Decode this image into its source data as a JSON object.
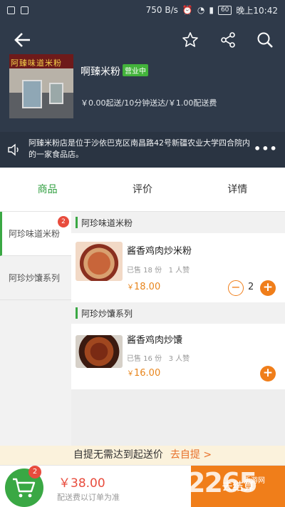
{
  "status_bar": {
    "speed": "750 B/s",
    "battery": "60",
    "time": "晚上10:42"
  },
  "shop": {
    "sign_text": "阿臻味道米粉",
    "name": "啊臻米粉",
    "status": "营业中",
    "info": "￥0.00起送/10分钟送达/￥1.00配送费",
    "notice": "阿臻米粉店是位于沙依巴克区南昌路42号新疆农业大学四合院内的一家食品店。",
    "more": "•••"
  },
  "tabs": [
    {
      "label": "商品",
      "active": true
    },
    {
      "label": "评价",
      "active": false
    },
    {
      "label": "详情",
      "active": false
    }
  ],
  "categories": [
    {
      "label": "阿珍味道米粉",
      "badge": "2",
      "active": true
    },
    {
      "label": "阿珍炒馕系列",
      "active": false
    }
  ],
  "sections": [
    {
      "title": "阿珍味道米粉",
      "product": {
        "name": "酱香鸡肉炒米粉",
        "sold": "已售 18 份",
        "likes": "1 人赞",
        "currency": "￥",
        "price": "18.00",
        "quantity": "2"
      }
    },
    {
      "title": "阿珍炒馕系列",
      "product": {
        "name": "酱香鸡肉炒馕",
        "sold": "已售 16 份",
        "likes": "3 人赞",
        "currency": "￥",
        "price": "16.00"
      }
    }
  ],
  "pickup": {
    "text": "自提无需达到起送价",
    "link": "去自提 >"
  },
  "cart": {
    "count": "2",
    "total": "￥38.00",
    "fee_note": "配送费以订单为准",
    "checkout": "去结算",
    "watermark": "2265",
    "watermark_sub": "手游网"
  },
  "colors": {
    "header_bg": "#2f3a4a",
    "accent_green": "#3aa844",
    "accent_orange": "#f07e1a",
    "badge_red": "#e84c3d"
  }
}
